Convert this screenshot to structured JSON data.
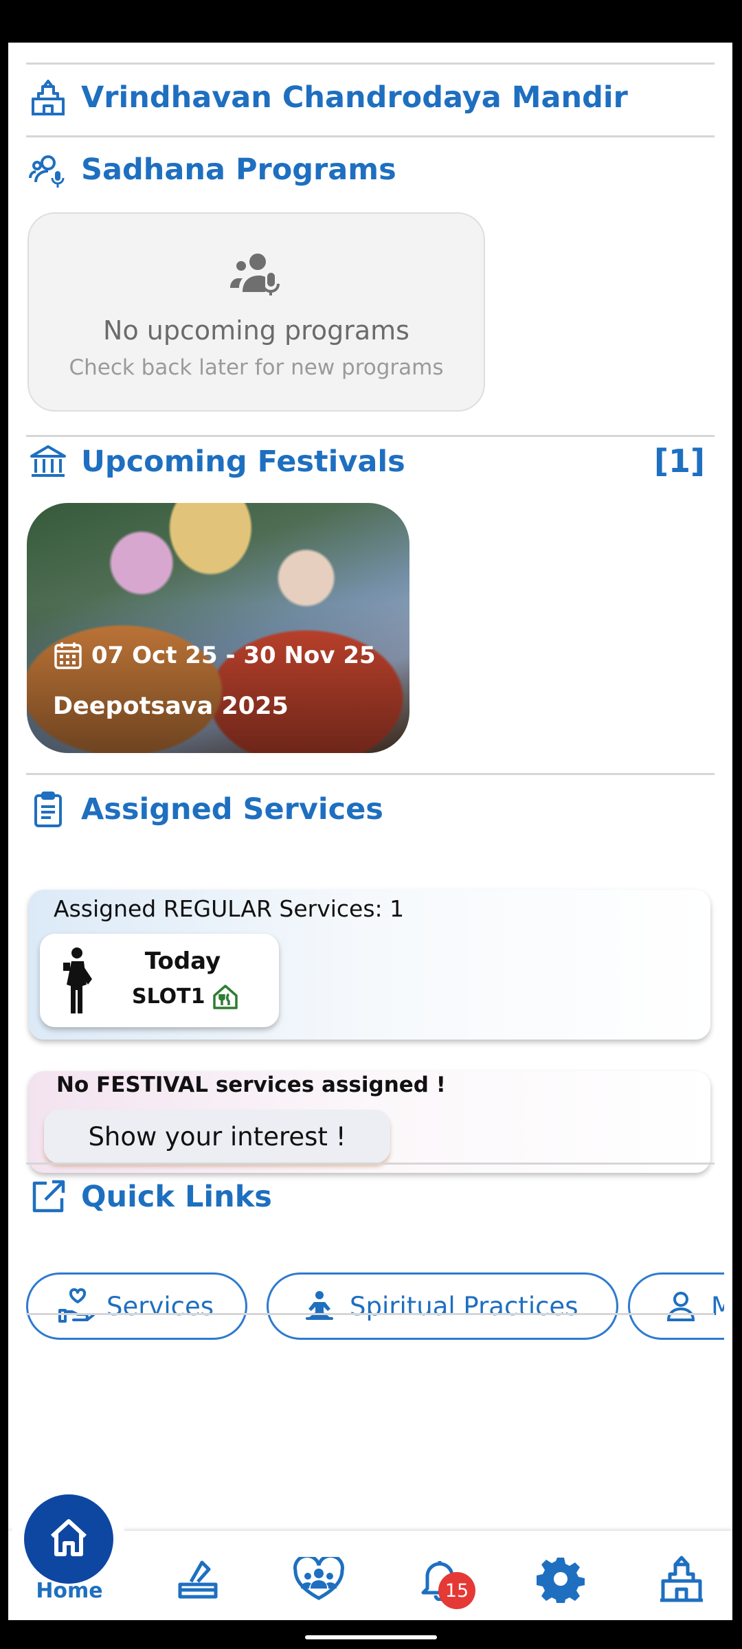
{
  "sections": {
    "temple": "Vrindhavan Chandrodaya Mandir",
    "sadhana": {
      "title": "Sadhana Programs",
      "empty_title": "No upcoming programs",
      "empty_sub": "Check back later for new programs"
    },
    "festivals": {
      "title": "Upcoming Festivals",
      "count": "[1]",
      "items": [
        {
          "date_range": "07 Oct 25 - 30 Nov 25",
          "name": "Deepotsava 2025"
        }
      ]
    },
    "assigned": {
      "title": "Assigned Services",
      "regular_header": "Assigned REGULAR Services: 1",
      "slot_day": "Today",
      "slot_name": "SLOT1",
      "festival_header": "No FESTIVAL services assigned !",
      "interest_button": "Show your interest !"
    },
    "quick_links": {
      "title": "Quick Links",
      "items": [
        "Services",
        "Spiritual Practices",
        "My Profile"
      ]
    }
  },
  "nav": {
    "home_label": "Home",
    "notification_count": "15",
    "icons": [
      "home-icon",
      "donation-icon",
      "community-icon",
      "bell-icon",
      "gear-icon",
      "temple-icon"
    ]
  },
  "colors": {
    "accent": "#1e6fc0",
    "fab": "#0e47a1",
    "badge": "#e53935"
  }
}
